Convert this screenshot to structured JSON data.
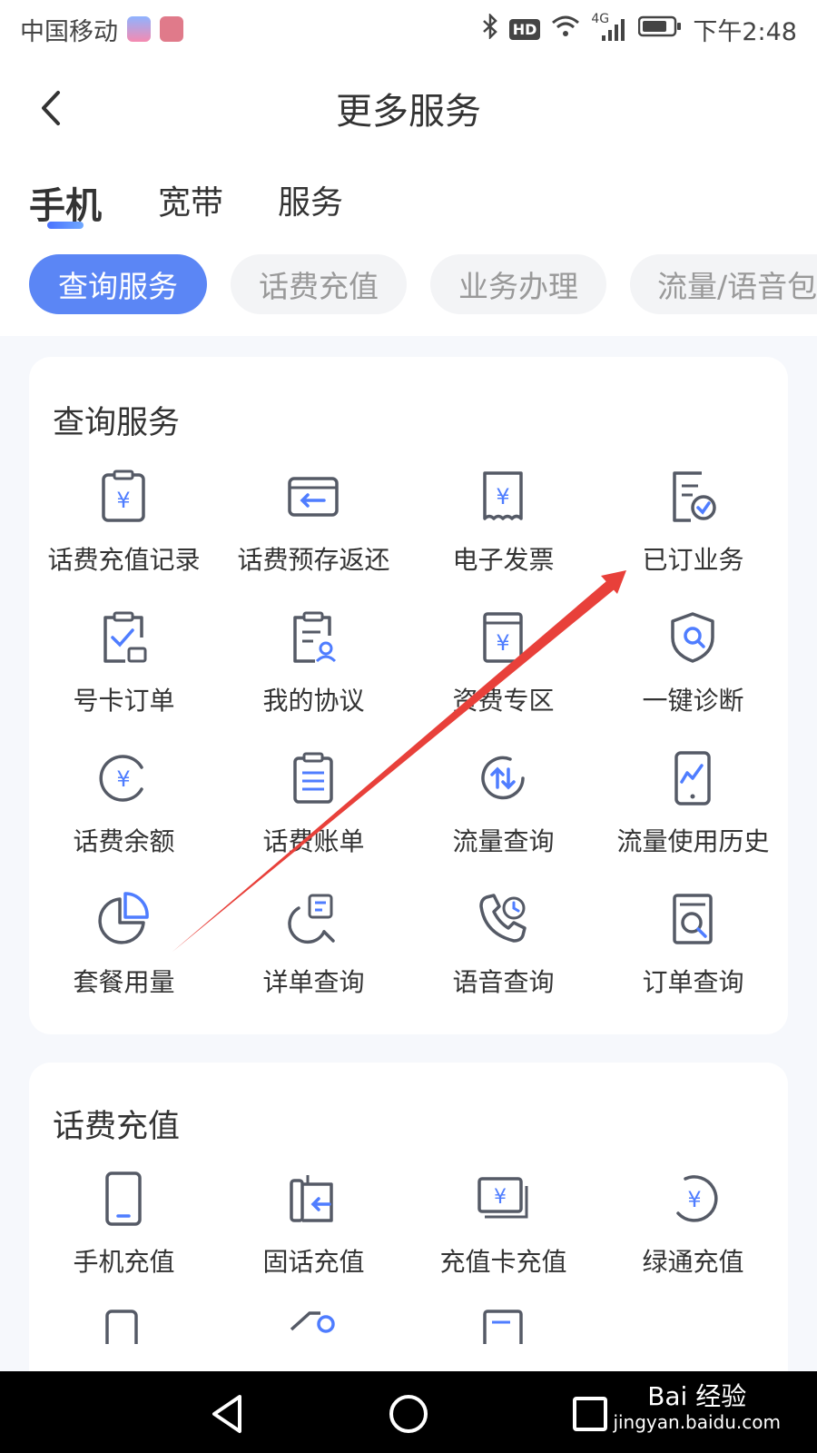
{
  "status_bar": {
    "carrier": "中国移动",
    "signal": "4G",
    "hd": "HD",
    "time": "下午2:48"
  },
  "header": {
    "title": "更多服务"
  },
  "top_tabs": [
    {
      "label": "手机"
    },
    {
      "label": "宽带"
    },
    {
      "label": "服务"
    }
  ],
  "chips": [
    {
      "label": "查询服务"
    },
    {
      "label": "话费充值"
    },
    {
      "label": "业务办理"
    },
    {
      "label": "流量/语音包"
    }
  ],
  "query_section": {
    "title": "查询服务",
    "items": [
      {
        "label": "话费充值记录",
        "icon": "recharge-record-icon"
      },
      {
        "label": "话费预存返还",
        "icon": "prepay-return-icon"
      },
      {
        "label": "电子发票",
        "icon": "e-invoice-icon"
      },
      {
        "label": "已订业务",
        "icon": "subscribed-service-icon"
      },
      {
        "label": "号卡订单",
        "icon": "card-order-icon"
      },
      {
        "label": "我的协议",
        "icon": "agreement-icon"
      },
      {
        "label": "资费专区",
        "icon": "tariff-icon"
      },
      {
        "label": "一键诊断",
        "icon": "diagnosis-icon"
      },
      {
        "label": "话费余额",
        "icon": "balance-icon"
      },
      {
        "label": "话费账单",
        "icon": "bill-icon"
      },
      {
        "label": "流量查询",
        "icon": "data-query-icon"
      },
      {
        "label": "流量使用历史",
        "icon": "data-history-icon"
      },
      {
        "label": "套餐用量",
        "icon": "plan-usage-icon"
      },
      {
        "label": "详单查询",
        "icon": "detail-query-icon"
      },
      {
        "label": "语音查询",
        "icon": "voice-query-icon"
      },
      {
        "label": "订单查询",
        "icon": "order-query-icon"
      }
    ]
  },
  "recharge_section": {
    "title": "话费充值",
    "items": [
      {
        "label": "手机充值",
        "icon": "phone-recharge-icon"
      },
      {
        "label": "固话充值",
        "icon": "landline-recharge-icon"
      },
      {
        "label": "充值卡充值",
        "icon": "card-recharge-icon"
      },
      {
        "label": "绿通充值",
        "icon": "green-recharge-icon"
      }
    ]
  },
  "watermark": {
    "brand": "Bai 经验",
    "url": "jingyan.baidu.com"
  },
  "colors": {
    "accent": "#5b86f5",
    "icon_stroke": "#555a66",
    "icon_accent": "#4f7dff",
    "annotation_arrow": "#e8403a"
  }
}
